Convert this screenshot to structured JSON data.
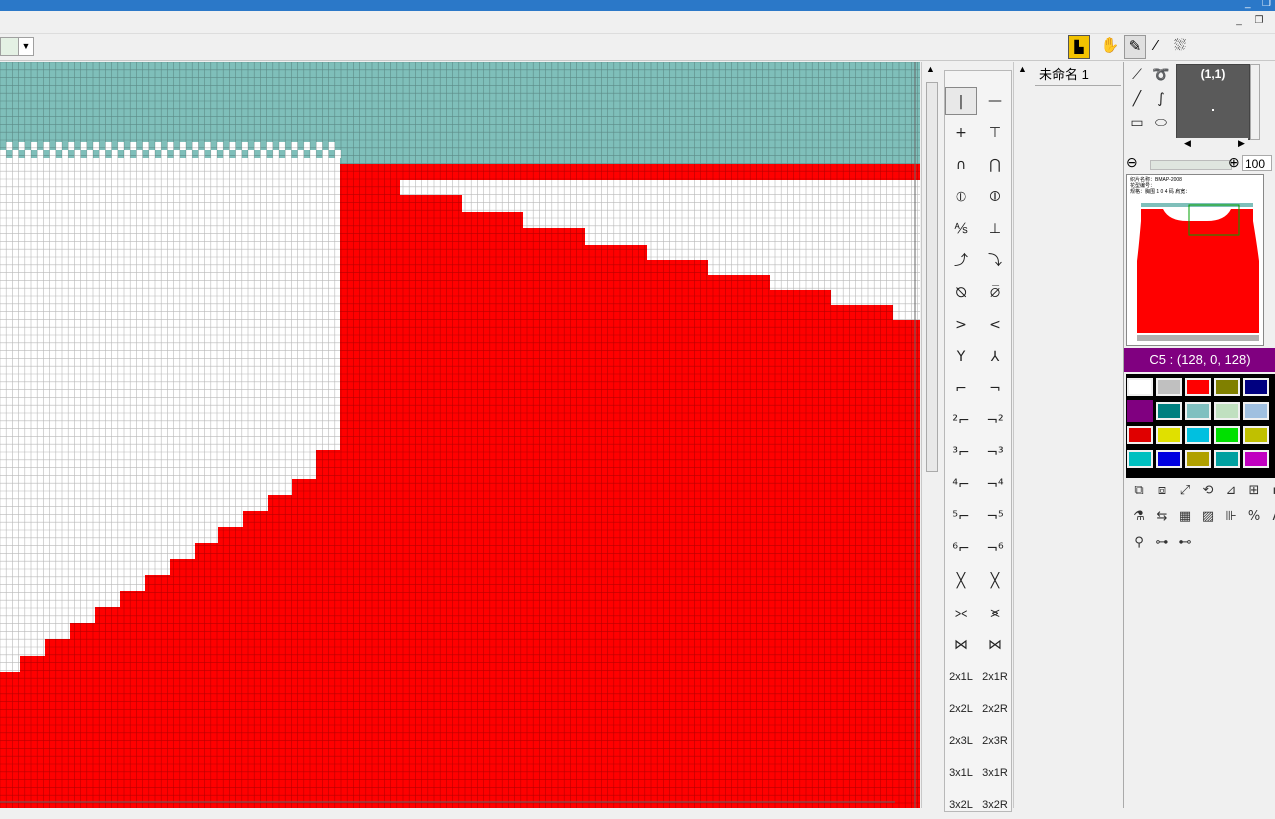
{
  "colors": {
    "titlebar": "#2b78c8",
    "teal": "#7fbfba",
    "red": "#ff0000",
    "gridline_white": "#9a9a9a",
    "gridline_red": "#ffc8c8",
    "selected_color": "#800080"
  },
  "toolbar": {
    "combo_arrow": "▼",
    "icons": [
      {
        "name": "sweater-shape-icon",
        "glyph": "▙"
      },
      {
        "name": "hand-pan-icon",
        "glyph": "✋"
      },
      {
        "name": "pencil-draw-icon",
        "glyph": "✎"
      },
      {
        "name": "line-draw-icon",
        "glyph": "⁄"
      },
      {
        "name": "spray-brush-icon",
        "glyph": "⛆"
      }
    ]
  },
  "window": {
    "minimize": "_",
    "restore": "❐"
  },
  "symbols": [
    [
      "|",
      "—"
    ],
    [
      "+",
      "⊤"
    ],
    [
      "∩",
      "⋂"
    ],
    [
      "⦶",
      "⦷"
    ],
    [
      "⅍",
      "⊥"
    ],
    [
      "⤴",
      "⤵"
    ],
    [
      "⦰",
      "⦱"
    ],
    [
      ">",
      "<"
    ],
    [
      "Y",
      "⅄"
    ],
    [
      "⌐",
      "¬"
    ],
    [
      "²⌐",
      "¬²"
    ],
    [
      "³⌐",
      "¬³"
    ],
    [
      "⁴⌐",
      "¬⁴"
    ],
    [
      "⁵⌐",
      "¬⁵"
    ],
    [
      "⁶⌐",
      "¬⁶"
    ],
    [
      "╳",
      "╳"
    ],
    [
      "⪥",
      "⪤"
    ],
    [
      "⋈",
      "⋈"
    ],
    [
      "2x1L",
      "2x1R"
    ],
    [
      "2x2L",
      "2x2R"
    ],
    [
      "2x3L",
      "2x3R"
    ],
    [
      "3x1L",
      "3x1R"
    ],
    [
      "3x2L",
      "3x2R"
    ]
  ],
  "tab": {
    "name": "未命名 1"
  },
  "preview": {
    "coord": "(1,1)"
  },
  "zoom": {
    "value": "100"
  },
  "thumbnail": {
    "text_lines": [
      "织片名称：BMAP-2008",
      "花型编号：",
      "规格：胸围 1 0 4 码  肩宽："
    ]
  },
  "current_color": {
    "label": "C5 : (128, 0, 128)"
  },
  "palette": [
    [
      "#ffffff",
      "#c0c0c0",
      "#ff0000",
      "#808000",
      "#000080"
    ],
    [
      "#800080",
      "#008080",
      "#80c0c0",
      "#c0e0c0",
      "#a0c0e0"
    ],
    [
      "#e00000",
      "#e0e000",
      "#00c0e0",
      "#00e000",
      "#c0c000"
    ],
    [
      "#00c0c0",
      "#0000e0",
      "#b0a000",
      "#00a0a0",
      "#c000c0"
    ]
  ],
  "tool_rows": [
    [
      "⧉",
      "⧈",
      "⤢",
      "⟲",
      "⊿",
      "⊞",
      "▪"
    ],
    [
      "⚗",
      "⇆",
      "▦",
      "▨",
      "⊪",
      "%",
      "A"
    ],
    [
      "⚲",
      "⊶",
      "⊷"
    ]
  ]
}
